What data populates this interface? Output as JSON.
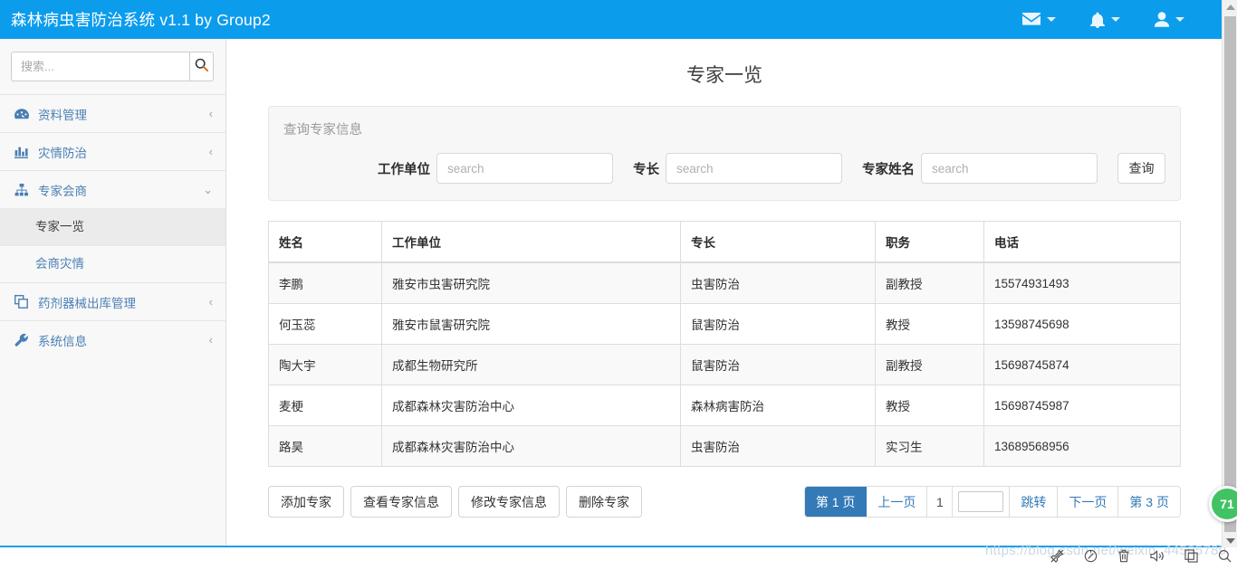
{
  "navbar": {
    "brand": "森林病虫害防治系统 v1.1 by Group2",
    "items": [
      {
        "icon": "envelope-icon",
        "name": "messages"
      },
      {
        "icon": "bell-icon",
        "name": "notifications"
      },
      {
        "icon": "user-icon",
        "name": "account"
      }
    ],
    "brand_color": "#0c9cec"
  },
  "sidebar": {
    "search": {
      "placeholder": "搜索...",
      "value": "",
      "icon": "search-icon"
    },
    "items": [
      {
        "label": "资料管理",
        "icon": "dashboard-icon",
        "chevron": "‹",
        "expanded": false
      },
      {
        "label": "灾情防治",
        "icon": "bar-chart-icon",
        "chevron": "‹",
        "expanded": false
      },
      {
        "label": "专家会商",
        "icon": "sitemap-icon",
        "chevron": "⌄",
        "expanded": true
      },
      {
        "label": "药剂器械出库管理",
        "icon": "clone-icon",
        "chevron": "‹",
        "expanded": false
      },
      {
        "label": "系统信息",
        "icon": "wrench-icon",
        "chevron": "‹",
        "expanded": false
      }
    ],
    "submenu": [
      {
        "label": "专家一览",
        "active": true
      },
      {
        "label": "会商灾情",
        "active": false
      }
    ]
  },
  "main": {
    "page_title": "专家一览",
    "search_panel": {
      "heading": "查询专家信息",
      "fields": [
        {
          "label": "工作单位",
          "placeholder": "search",
          "value": ""
        },
        {
          "label": "专长",
          "placeholder": "search",
          "value": ""
        },
        {
          "label": "专家姓名",
          "placeholder": "search",
          "value": ""
        }
      ],
      "submit_label": "查询"
    },
    "table": {
      "columns": [
        "姓名",
        "工作单位",
        "专长",
        "职务",
        "电话"
      ],
      "rows": [
        {
          "name": "李鹏",
          "unit": "雅安市虫害研究院",
          "specialty": "虫害防治",
          "title": "副教授",
          "phone": "15574931493"
        },
        {
          "name": "何玉蕊",
          "unit": "雅安市鼠害研究院",
          "specialty": "鼠害防治",
          "title": "教授",
          "phone": "13598745698"
        },
        {
          "name": "陶大宇",
          "unit": "成都生物研究所",
          "specialty": "鼠害防治",
          "title": "副教授",
          "phone": "15698745874"
        },
        {
          "name": "麦梗",
          "unit": "成都森林灾害防治中心",
          "specialty": "森林病害防治",
          "title": "教授",
          "phone": "15698745987"
        },
        {
          "name": "路昊",
          "unit": "成都森林灾害防治中心",
          "specialty": "虫害防治",
          "title": "实习生",
          "phone": "13689568956"
        }
      ]
    },
    "actions": [
      {
        "label": "添加专家"
      },
      {
        "label": "查看专家信息"
      },
      {
        "label": "修改专家信息"
      },
      {
        "label": "删除专家"
      }
    ],
    "pagination": {
      "current_label": "第 1 页",
      "prev_label": "上一页",
      "page_number": "1",
      "jump_value": "",
      "jump_label": "跳转",
      "next_label": "下一页",
      "last_label": "第 3 页",
      "active_color": "#337ab7"
    }
  },
  "overlay": {
    "badge": "71",
    "badge_color": "#41c363",
    "watermark": "https://blog.csdn.net/weixin_44505789"
  },
  "bottom_toolbar": [
    {
      "icon": "pin-icon"
    },
    {
      "icon": "compass-icon"
    },
    {
      "icon": "trash-icon"
    },
    {
      "icon": "speaker-icon"
    },
    {
      "icon": "copy-icon"
    },
    {
      "icon": "search-icon"
    }
  ]
}
